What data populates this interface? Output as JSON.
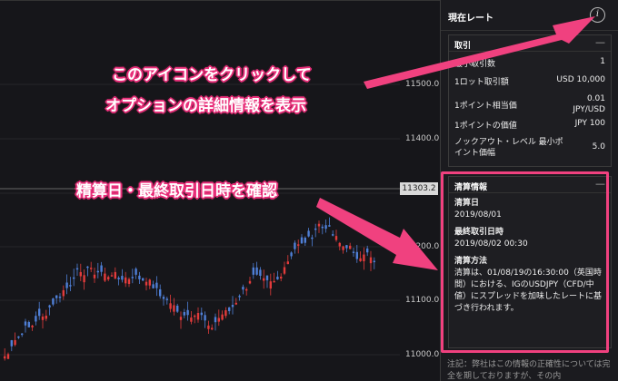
{
  "chart": {
    "price_labels": [
      "11500.0",
      "11400.0",
      "11200.0",
      "11100.0",
      "11000.0"
    ],
    "current_price": "11303.2"
  },
  "panel": {
    "title": "現在レート",
    "trade_section": {
      "title": "取引",
      "collapse": "—",
      "rows": [
        {
          "label": "最小取引数",
          "value": "1"
        },
        {
          "label": "1ロット取引額",
          "value": "USD 10,000"
        },
        {
          "label": "1ポイント相当価",
          "value": "0.01 JPY/USD"
        },
        {
          "label": "1ポイントの価値",
          "value": "JPY 100"
        },
        {
          "label": "ノックアウト・レベル 最小ポイント価幅",
          "value": "5.0"
        }
      ]
    },
    "settlement_section": {
      "title": "清算情報",
      "collapse": "—",
      "date_label": "清算日",
      "date_value": "2019/08/01",
      "last_trade_label": "最終取引日時",
      "last_trade_value": "2019/08/02 00:30",
      "method_label": "清算方法",
      "method_value": "清算は、01/08/19の16:30:00（英国時間）における、IGのUSDJPY（CFD/中値）にスプレッドを加味したレートに基づき行われます。"
    },
    "note": "注記：弊社はこの情報の正確性については完全を期しておりますが、その内"
  },
  "annotations": {
    "icon_hint_line1": "このアイコンをクリックして",
    "icon_hint_line2": "オプションの詳細情報を表示",
    "settlement_hint": "精算日・最終取引日時を確認"
  },
  "colors": {
    "up": "#e23b3b",
    "down": "#4f7fd6",
    "annotation": "#f0417f"
  }
}
